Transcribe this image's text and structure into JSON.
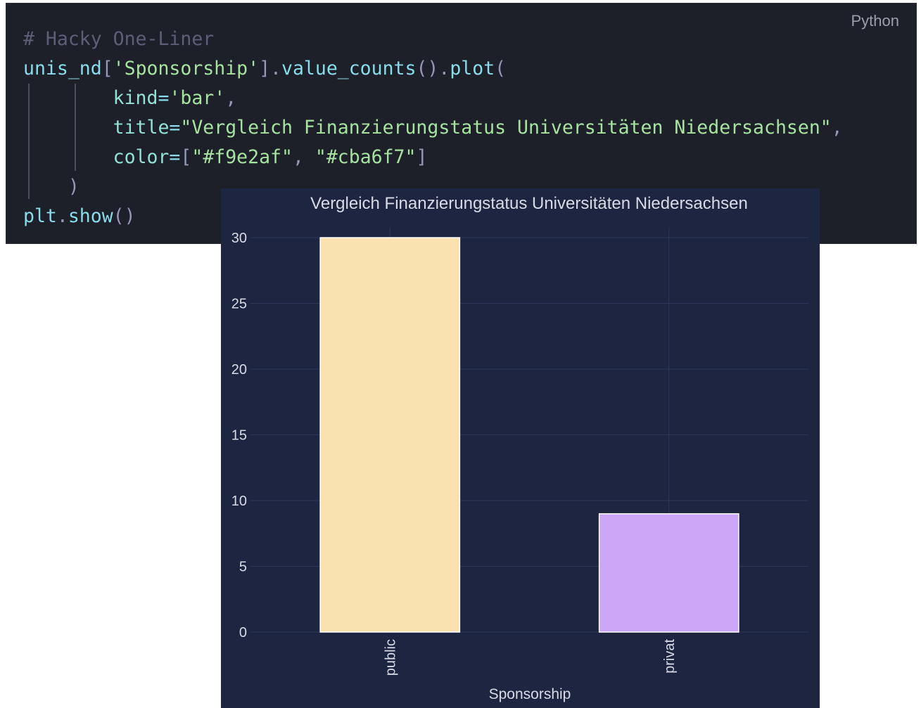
{
  "code_block": {
    "language": "Python",
    "lines": [
      [
        {
          "t": "# Hacky One-Liner",
          "c": "c-comment"
        }
      ],
      [
        {
          "t": "unis_nd",
          "c": "c-ident"
        },
        {
          "t": "[",
          "c": "c-punct"
        },
        {
          "t": "'Sponsorship'",
          "c": "c-str"
        },
        {
          "t": "].",
          "c": "c-punct"
        },
        {
          "t": "value_counts",
          "c": "c-ident"
        },
        {
          "t": "().",
          "c": "c-punct"
        },
        {
          "t": "plot",
          "c": "c-ident"
        },
        {
          "t": "(",
          "c": "c-punct"
        }
      ],
      [
        {
          "t": "        ",
          "c": ""
        },
        {
          "t": "kind",
          "c": "c-param"
        },
        {
          "t": "=",
          "c": "c-op"
        },
        {
          "t": "'bar'",
          "c": "c-str"
        },
        {
          "t": ",",
          "c": "c-punct"
        }
      ],
      [
        {
          "t": "        ",
          "c": ""
        },
        {
          "t": "title",
          "c": "c-param"
        },
        {
          "t": "=",
          "c": "c-op"
        },
        {
          "t": "\"Vergleich Finanzierungstatus Universitäten Niedersachsen\"",
          "c": "c-str"
        },
        {
          "t": ",",
          "c": "c-punct"
        }
      ],
      [
        {
          "t": "        ",
          "c": ""
        },
        {
          "t": "color",
          "c": "c-param"
        },
        {
          "t": "=",
          "c": "c-op"
        },
        {
          "t": "[",
          "c": "c-punct"
        },
        {
          "t": "\"#f9e2af\"",
          "c": "c-str"
        },
        {
          "t": ", ",
          "c": "c-punct"
        },
        {
          "t": "\"#cba6f7\"",
          "c": "c-str"
        },
        {
          "t": "]",
          "c": "c-punct"
        }
      ],
      [
        {
          "t": "    ",
          "c": ""
        },
        {
          "t": ")",
          "c": "c-punct"
        }
      ],
      [
        {
          "t": "plt",
          "c": "c-ident"
        },
        {
          "t": ".",
          "c": "c-punct"
        },
        {
          "t": "show",
          "c": "c-ident"
        },
        {
          "t": "()",
          "c": "c-punct"
        }
      ]
    ]
  },
  "chart_data": {
    "type": "bar",
    "title": "Vergleich Finanzierungstatus Universitäten Niedersachsen",
    "xlabel": "Sponsorship",
    "ylabel": "",
    "categories": [
      "public",
      "privat"
    ],
    "values": [
      30,
      9
    ],
    "colors": [
      "#f9e2af",
      "#cba6f7"
    ],
    "ylim": [
      0,
      30
    ],
    "yticks": [
      0,
      5,
      10,
      15,
      20,
      25,
      30
    ],
    "grid": true,
    "legend": "none",
    "background": "#1e2540"
  }
}
